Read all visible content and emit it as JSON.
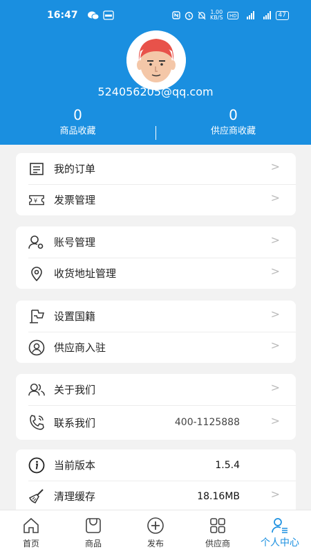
{
  "statusbar": {
    "time": "16:47",
    "speed": "1.00\nKB/S",
    "battery": "47"
  },
  "profile": {
    "email": "524056205@qq.com"
  },
  "stats": [
    {
      "count": "0",
      "label": "商品收藏"
    },
    {
      "count": "0",
      "label": "供应商收藏"
    }
  ],
  "menu": {
    "orders": "我的订单",
    "invoice": "发票管理",
    "account": "账号管理",
    "address": "收货地址管理",
    "nationality": "设置国籍",
    "supplier_join": "供应商入驻",
    "about": "关于我们",
    "contact": "联系我们",
    "contact_phone": "400-1125888",
    "version": "当前版本",
    "version_value": "1.5.4",
    "cache": "清理缓存",
    "cache_value": "18.16MB",
    "chevron": ">"
  },
  "tabs": [
    {
      "label": "首页",
      "icon": "home-icon"
    },
    {
      "label": "商品",
      "icon": "bag-icon"
    },
    {
      "label": "发布",
      "icon": "plus-circle-icon"
    },
    {
      "label": "供应商",
      "icon": "grid-icon"
    },
    {
      "label": "个人中心",
      "icon": "user-list-icon"
    }
  ],
  "colors": {
    "brand": "#1a8fe0",
    "background": "#f2f2f2",
    "avatar_face": "#f4c7a8",
    "avatar_hair": "#e8524a"
  }
}
